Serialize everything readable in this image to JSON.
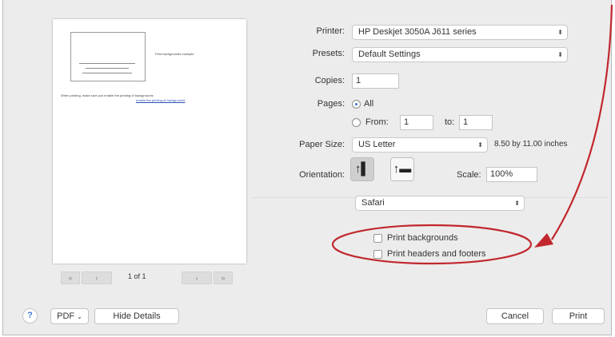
{
  "preview": {
    "thumb_heading": "Print backgrounds example",
    "thumb_caption": "When printing, make sure you enable the printing of backgrounds",
    "thumb_link": "enable the printing of backgrounds",
    "page_indicator": "1 of 1",
    "prev_first": "«",
    "prev": "‹",
    "next": "›",
    "next_last": "»"
  },
  "form": {
    "printer_label": "Printer:",
    "printer_value": "HP Deskjet 3050A J611 series",
    "presets_label": "Presets:",
    "presets_value": "Default Settings",
    "copies_label": "Copies:",
    "copies_value": "1",
    "pages_label": "Pages:",
    "pages_all": "All",
    "pages_from": "From:",
    "pages_from_value": "1",
    "pages_to": "to:",
    "pages_to_value": "1",
    "paper_size_label": "Paper Size:",
    "paper_size_value": "US Letter",
    "paper_size_dims": "8.50 by 11.00 inches",
    "orientation_label": "Orientation:",
    "scale_label": "Scale:",
    "scale_value": "100%",
    "app_section_value": "Safari",
    "print_backgrounds": "Print backgrounds",
    "print_headers_footers": "Print headers and footers"
  },
  "footer": {
    "help": "?",
    "pdf": "PDF",
    "hide_details": "Hide Details",
    "cancel": "Cancel",
    "print": "Print"
  },
  "icons": {
    "popup_chevron": "updown-chevron-icon",
    "portrait": "portrait-orientation-icon",
    "landscape": "landscape-orientation-icon"
  },
  "colors": {
    "annotation": "#c1272d",
    "accent": "#3b6fd8",
    "dialog_bg": "#ececec"
  }
}
